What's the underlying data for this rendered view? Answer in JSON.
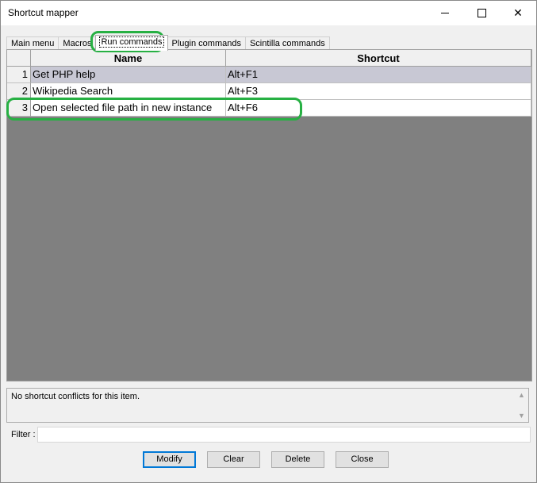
{
  "window": {
    "title": "Shortcut mapper"
  },
  "titlebar_buttons": {
    "close_glyph": "✕"
  },
  "tabs": [
    {
      "label": "Main menu",
      "active": false
    },
    {
      "label": "Macros",
      "active": false
    },
    {
      "label": "Run commands",
      "active": true
    },
    {
      "label": "Plugin commands",
      "active": false
    },
    {
      "label": "Scintilla commands",
      "active": false
    }
  ],
  "grid": {
    "columns": {
      "name": "Name",
      "shortcut": "Shortcut"
    },
    "rows": [
      {
        "num": "1",
        "name": "Get PHP help",
        "shortcut": "Alt+F1",
        "selected": true
      },
      {
        "num": "2",
        "name": "Wikipedia Search",
        "shortcut": "Alt+F3",
        "selected": false
      },
      {
        "num": "3",
        "name": "Open selected file path in new instance",
        "shortcut": "Alt+F6",
        "selected": false
      }
    ]
  },
  "conflict": {
    "text": "No shortcut conflicts for this item."
  },
  "filter": {
    "label": "Filter :",
    "value": ""
  },
  "buttons": {
    "modify": "Modify",
    "clear": "Clear",
    "delete": "Delete",
    "close": "Close"
  },
  "colors": {
    "annotation": "#27b043",
    "selected_row": "#c8c8d4",
    "grid_bg": "#808080",
    "default_button_border": "#0078d7"
  }
}
